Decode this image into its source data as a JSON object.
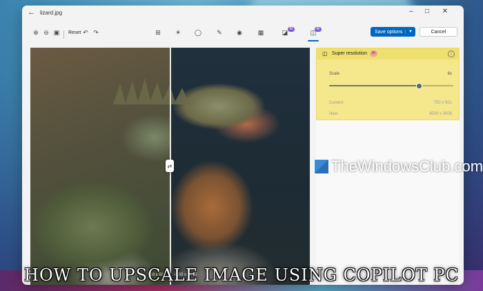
{
  "window": {
    "title": "lizard.jpg"
  },
  "toolbar": {
    "reset_label": "Reset",
    "ai_badge": "AI",
    "save_label": "Save options",
    "cancel_label": "Cancel",
    "icons": [
      "zoom-in-icon",
      "zoom-out-icon",
      "fit-view-icon",
      "undo-icon",
      "redo-icon",
      "crop-icon",
      "adjust-icon",
      "filter-icon",
      "markup-icon",
      "erase-icon",
      "effects-icon",
      "background-icon",
      "super-resolution-icon"
    ]
  },
  "canvas": {
    "current_resolution": "750 x 501",
    "new_resolution": "4500 x 3006"
  },
  "panel": {
    "title": "Super resolution",
    "ai_badge": "AI",
    "scale_label": "Scale",
    "scale_value": "6x",
    "scale_fraction": 0.72,
    "current_label": "Current:",
    "current_value": "750 x 501",
    "new_label": "New:",
    "new_value": "4500 x 3006"
  },
  "watermark": "TheWindowsClub.com",
  "caption": "HOW TO UPSCALE IMAGE USING COPILOT PC",
  "colors": {
    "accent": "#0067c0",
    "highlight": "#f5e88c",
    "ai_badge": "#7b5cd6"
  }
}
